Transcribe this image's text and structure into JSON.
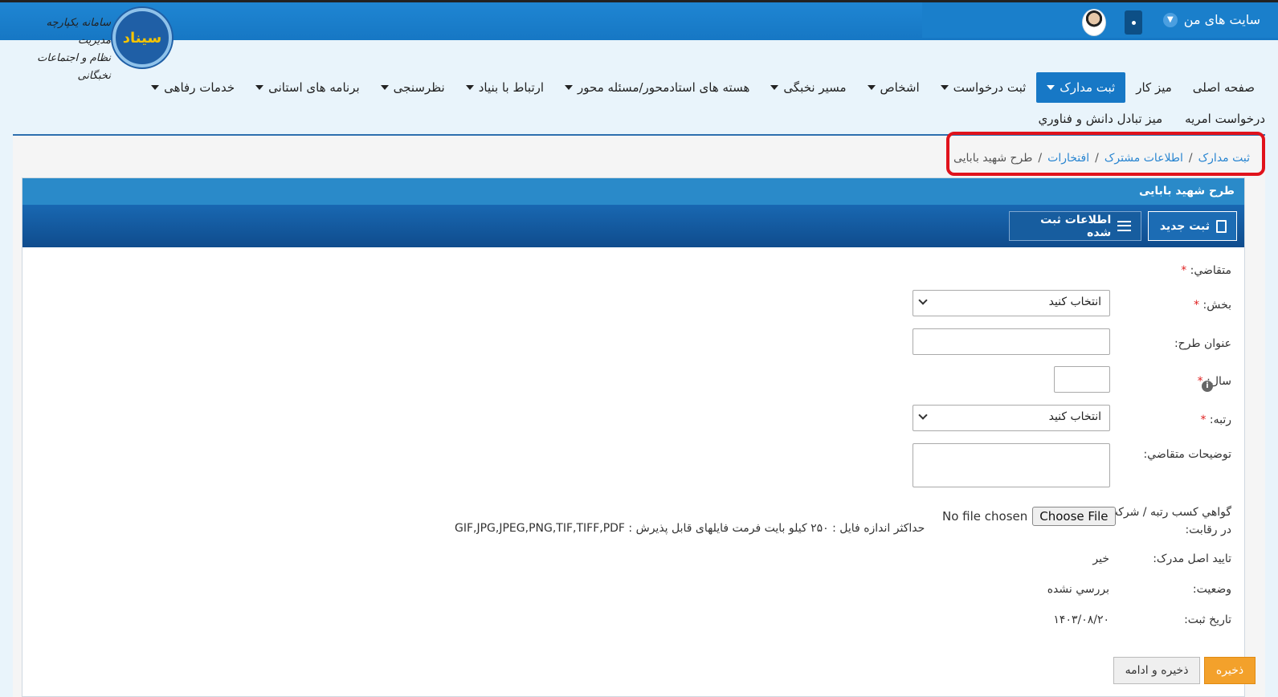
{
  "topbar": {
    "my_sites": "سایت های من"
  },
  "logo": {
    "brand": "سیناد",
    "line1": "سامانه یکپارچه مدیریت",
    "line2": "نظام و اجتماعات نخبگانی"
  },
  "nav": {
    "items": [
      {
        "label": "صفحه اصلی",
        "dropdown": false,
        "active": false
      },
      {
        "label": "میز کار",
        "dropdown": false,
        "active": false
      },
      {
        "label": "ثبت مدارک",
        "dropdown": true,
        "active": true
      },
      {
        "label": "ثبت درخواست",
        "dropdown": true,
        "active": false
      },
      {
        "label": "اشخاص",
        "dropdown": true,
        "active": false
      },
      {
        "label": "مسیر نخبگی",
        "dropdown": true,
        "active": false
      },
      {
        "label": "هسته های استادمحور/مسئله محور",
        "dropdown": true,
        "active": false
      },
      {
        "label": "ارتباط با بنیاد",
        "dropdown": true,
        "active": false
      },
      {
        "label": "نظرسنجی",
        "dropdown": true,
        "active": false
      },
      {
        "label": "برنامه های استانی",
        "dropdown": true,
        "active": false
      },
      {
        "label": "خدمات رفاهی",
        "dropdown": true,
        "active": false
      }
    ],
    "row2": [
      "میز تبادل دانش و فناوري",
      "درخواست امریه"
    ]
  },
  "breadcrumb": {
    "links": [
      "ثبت مدارک",
      "اطلاعات مشترک",
      "افتخارات"
    ],
    "current": "طرح شهید بابایی",
    "separator": "/"
  },
  "card": {
    "title": "طرح شهید بابایی",
    "new_button": "ثبت جدید",
    "registered_button": "اطلاعات ثبت شده"
  },
  "form": {
    "applicant_label": "متقاضي:",
    "section_label": "بخش:",
    "section_value": "انتخاب کنید",
    "plan_title_label": "عنوان طرح:",
    "year_label": "سال:",
    "rank_label": "رتبه:",
    "rank_value": "انتخاب کنید",
    "description_label": "توضيحات متقاضي:",
    "certificate_label_1": "گواهي کسب رتبه / شرکت",
    "certificate_label_2": "در رقابت:",
    "choose_file": "Choose File",
    "no_file": "No file chosen",
    "file_hint": "حداکثر اندازه فایل : ۲۵۰ کیلو بایت فرمت فایلهای قابل پذیرش : GIF,JPG,JPEG,PNG,TIF,TIFF,PDF",
    "original_confirm_label": "تایید اصل مدرک:",
    "original_confirm_value": "خير",
    "status_label": "وضعيت:",
    "status_value": "بررسي نشده",
    "date_label": "تاريخ ثبت:",
    "date_value": "۱۴۰۳/۰۸/۲۰",
    "required_mark": "*",
    "info_mark": "i"
  },
  "actions": {
    "save": "ذخیره",
    "save_continue": "ذخیره و ادامه"
  },
  "colors": {
    "primary": "#1778c6",
    "highlight": "#e0131c",
    "save": "#f3a12b",
    "link": "#2a86d1"
  }
}
